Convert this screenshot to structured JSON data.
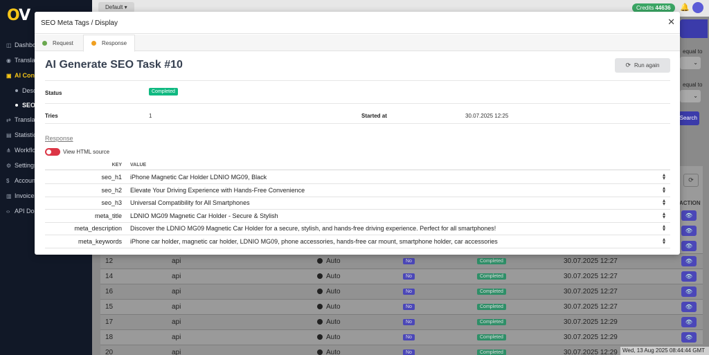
{
  "logo": {
    "text_a": "O",
    "text_b": "V"
  },
  "sidebar": {
    "items": [
      {
        "icon": "dashboard-icon",
        "label": "Dashbo"
      },
      {
        "icon": "globe-icon",
        "label": "Translat"
      },
      {
        "icon": "robot-icon",
        "label": "AI Cont"
      },
      {
        "label": "Desc"
      },
      {
        "label": "SEO"
      },
      {
        "icon": "translate-icon",
        "label": "Translat"
      },
      {
        "icon": "chart-icon",
        "label": "Statistic"
      },
      {
        "icon": "workflow-icon",
        "label": "Workflo"
      },
      {
        "icon": "gear-icon",
        "label": "Settings"
      },
      {
        "icon": "dollar-icon",
        "label": "Accoun"
      },
      {
        "icon": "invoice-icon",
        "label": "Invoices"
      },
      {
        "icon": "code-icon",
        "label": "API Doc"
      }
    ]
  },
  "topbar": {
    "default_label": "Default ▾",
    "credits_label": "Credits",
    "credits_value": "44636"
  },
  "filters": {
    "equal_to_1": "equal to",
    "equal_to_2": "equal to",
    "search_label": "Search"
  },
  "table": {
    "action_header": "ACTION",
    "rows": [
      {
        "id": "12",
        "source": "api",
        "mode": "Auto",
        "flag": "No",
        "status": "Completed",
        "date": "30.07.2025 12:27"
      },
      {
        "id": "14",
        "source": "api",
        "mode": "Auto",
        "flag": "No",
        "status": "Completed",
        "date": "30.07.2025 12:27"
      },
      {
        "id": "16",
        "source": "api",
        "mode": "Auto",
        "flag": "No",
        "status": "Completed",
        "date": "30.07.2025 12:27"
      },
      {
        "id": "15",
        "source": "api",
        "mode": "Auto",
        "flag": "No",
        "status": "Completed",
        "date": "30.07.2025 12:27"
      },
      {
        "id": "17",
        "source": "api",
        "mode": "Auto",
        "flag": "No",
        "status": "Completed",
        "date": "30.07.2025 12:29"
      },
      {
        "id": "18",
        "source": "api",
        "mode": "Auto",
        "flag": "No",
        "status": "Completed",
        "date": "30.07.2025 12:29"
      },
      {
        "id": "20",
        "source": "api",
        "mode": "Auto",
        "flag": "No",
        "status": "Completed",
        "date": "30.07.2025 12:29"
      }
    ]
  },
  "clock": "Wed, 13 Aug 2025 08:44:44 GMT",
  "modal": {
    "title": "SEO Meta Tags / Display",
    "tabs": [
      {
        "label": "Request",
        "dot_color": "#6aa84f"
      },
      {
        "label": "Response",
        "dot_color": "#f0a020"
      }
    ],
    "task_title": "AI Generate SEO Task #10",
    "run_again": "Run again",
    "status_label": "Status",
    "status_value": "Completed",
    "tries_label": "Tries",
    "tries_value": "1",
    "started_label": "Started at",
    "started_value": "30.07.2025 12:25",
    "response_label": "Response",
    "view_html_label": "View HTML source",
    "kv_headers": {
      "key": "KEY",
      "value": "VALUE"
    },
    "kv": [
      {
        "key": "seo_h1",
        "value": "iPhone Magnetic Car Holder LDNIO MG09, Black"
      },
      {
        "key": "seo_h2",
        "value": "Elevate Your Driving Experience with Hands-Free Convenience"
      },
      {
        "key": "seo_h3",
        "value": "Universal Compatibility for All Smartphones"
      },
      {
        "key": "meta_title",
        "value": "LDNIO MG09 Magnetic Car Holder - Secure & Stylish"
      },
      {
        "key": "meta_description",
        "value": "Discover the LDNIO MG09 Magnetic Car Holder for a secure, stylish, and hands-free driving experience. Perfect for all smartphones!"
      },
      {
        "key": "meta_keywords",
        "value": "iPhone car holder, magnetic car holder, LDNIO MG09, phone accessories, hands-free car mount, smartphone holder, car accessories"
      }
    ]
  },
  "colors": {
    "sidebar_bg": "#111827",
    "accent": "#f5c518",
    "primary": "#4b47b8",
    "success": "#10b981",
    "danger": "#dc3545"
  }
}
